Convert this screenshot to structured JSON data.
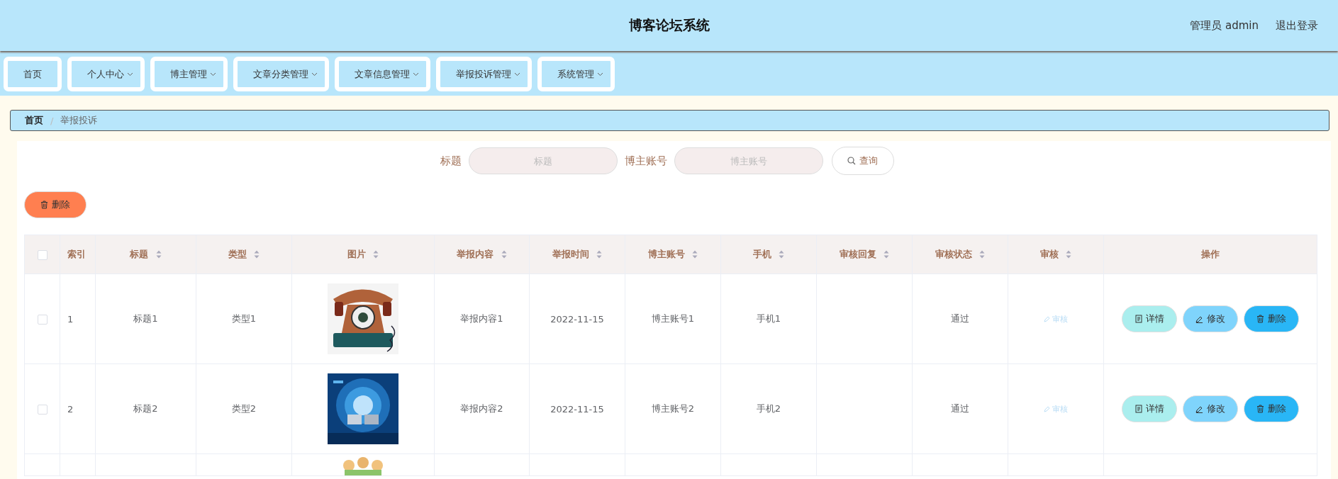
{
  "header": {
    "title": "博客论坛系统",
    "user": "管理员 admin",
    "logout": "退出登录"
  },
  "nav": [
    {
      "label": "首页",
      "has_menu": false
    },
    {
      "label": "个人中心",
      "has_menu": true
    },
    {
      "label": "博主管理",
      "has_menu": true
    },
    {
      "label": "文章分类管理",
      "has_menu": true
    },
    {
      "label": "文章信息管理",
      "has_menu": true
    },
    {
      "label": "举报投诉管理",
      "has_menu": true
    },
    {
      "label": "系统管理",
      "has_menu": true
    }
  ],
  "breadcrumb": {
    "items": [
      "首页",
      "举报投诉"
    ],
    "separator": "/"
  },
  "search": {
    "fields": [
      {
        "label": "标题",
        "placeholder": "标题"
      },
      {
        "label": "博主账号",
        "placeholder": "博主账号"
      }
    ],
    "button": "查询"
  },
  "delete_button": "删除",
  "table": {
    "header_checked": false,
    "columns": [
      {
        "label": "索引",
        "sortable": false
      },
      {
        "label": "标题",
        "sortable": true
      },
      {
        "label": "类型",
        "sortable": true
      },
      {
        "label": "图片",
        "sortable": true
      },
      {
        "label": "举报内容",
        "sortable": true
      },
      {
        "label": "举报时间",
        "sortable": true
      },
      {
        "label": "博主账号",
        "sortable": true
      },
      {
        "label": "手机",
        "sortable": true
      },
      {
        "label": "审核回复",
        "sortable": true
      },
      {
        "label": "审核状态",
        "sortable": true
      },
      {
        "label": "审核",
        "sortable": true
      },
      {
        "label": "操作",
        "sortable": false
      }
    ],
    "rows": [
      {
        "checked": false,
        "index": "1",
        "title": "标题1",
        "type": "类型1",
        "content": "举报内容1",
        "time": "2022-11-15",
        "account": "博主账号1",
        "phone": "手机1",
        "status": "通过",
        "review": "审核",
        "review_disabled": true,
        "actions": [
          "详情",
          "修改",
          "删除"
        ]
      },
      {
        "checked": false,
        "index": "2",
        "title": "标题2",
        "type": "类型2",
        "content": "举报内容2",
        "time": "2022-11-15",
        "account": "博主账号2",
        "phone": "手机2",
        "status": "通过",
        "review": "审核",
        "review_disabled": true,
        "actions": [
          "详情",
          "修改",
          "删除"
        ]
      }
    ]
  }
}
